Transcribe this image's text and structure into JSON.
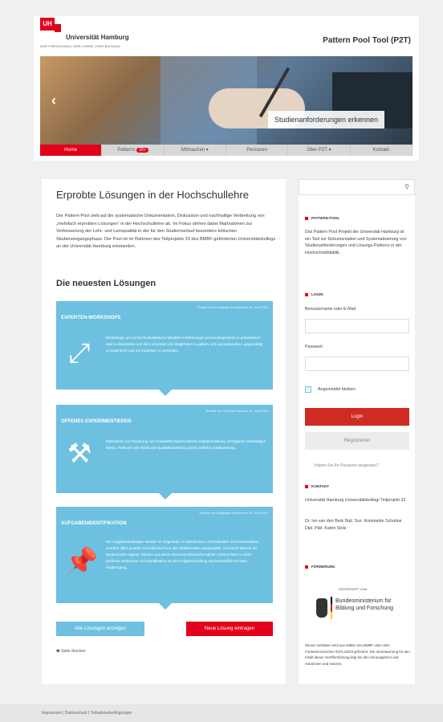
{
  "header": {
    "logo_text": "UH",
    "university": "Universität Hamburg",
    "tagline": "DER FORSCHUNG | DER LEHRE | DER BILDUNG",
    "tool_title": "Pattern Pool Tool (P2T)"
  },
  "hero": {
    "caption": "Studienanforderungen erkennen",
    "prev_icon": "chevron-left-icon"
  },
  "nav": {
    "items": [
      {
        "label": "Home"
      },
      {
        "label": "Patterns",
        "badge": "20+"
      },
      {
        "label": "Mitmachen ▾"
      },
      {
        "label": "Personen"
      },
      {
        "label": "Über P2T ▾"
      },
      {
        "label": "Kontakt"
      }
    ]
  },
  "main": {
    "title": "Erprobte Lösungen in der Hochschullehre",
    "intro": "Der Pattern-Pool zielt auf die systematische Dokumentation, Diskussion und nachhaltige Verbreitung von „mehrfach erprobten Lösungen“ in der Hochschullehre ab. Im Fokus stehen dabei Maßnahmen zur Verbesserung der Lehr- und Lernqualität in der für den Studienverlauf besonders kritischen Studieneingangsphase. Der Pool ist im Rahmen des Teilprojekts 33 des BMBF-geförderten Universitätskollegs an der Universität Hamburg entstanden.",
    "section_title": "Die neuesten Lösungen",
    "cards": [
      {
        "meta": "Erstellt von Konstantin Schultes am 24. Juni 2016",
        "title": "EXPERTEN-WORKSHOPS",
        "text": "Workshops, um hochschuldidaktische fakultäre Insellösungen prozessbegleitend zu präsentieren und zu diskutieren und den Lehrenden die Möglichkeit zu geben, sich auszutauschen, gegenseitig zu inspirieren und mit Expertise zu versorgen.",
        "icon": "expand-arrows-icon"
      },
      {
        "meta": "Erstellt von Thomas Haidl am 16. Juni 2016",
        "title": "OFFENES EXPERIMENTIEREN",
        "text": "Maßnahme zur Förderung von Kreativität ergebnisoffene Aufgabenstellung. Ermöglicht nachhaltiges lernen. Reflexion der Inhalt und Qualitätssicherung durch zeitliche Strukturierung.",
        "icon": "hammer-icon"
      },
      {
        "meta": "Erstellt von Wolfgang Reichert am 16. Juni 2016",
        "title": "AUFGABENIDENTIFIKATION",
        "text": "Die Aufgabenstellungen werden im Gegensatz zu klassischen Lehrmethoden nicht konkretisiert, sondern offen gestellt und individuell von den Studierenden ausgestaltet. Hierdurch können die Studierenden eigene Themen aus deren Interessensbereiche wählen. Dieses führt zu einer größeren Motivation und Identifikation mit der Aufgabenstellung und letztendlich mit dem Studiengang.",
        "icon": "pushpin-icon"
      }
    ],
    "show_all_label": "Alle Lösungen anzeigen",
    "new_solution_label": "Neue Lösung eintragen",
    "print_label": "Seite drucken"
  },
  "sidebar": {
    "search_placeholder": "",
    "pattern_pool": {
      "heading": "PATTERN POOL",
      "text": "Das Pattern Pool Projekt der Universität Hamburg ist ein Tool zur Dokumentation und Systematisierung von Studienanforderungen und Lösungs-Patterns in der Hochschuldidaktik."
    },
    "login": {
      "heading": "LOGIN",
      "user_label": "Benutzername oder E-Mail",
      "password_label": "Passwort",
      "remember_label": "Angemeldet bleiben",
      "login_button": "Login",
      "register_button": "Registrieren",
      "forgot": "Haben Sie Ihr Passwort vergessen?"
    },
    "kontakt": {
      "heading": "KONTAKT",
      "org": "Universität Hamburg Universitätskolleg/ Teilprojekt 33",
      "people": "Dr. Ivo van den Berk Dipl. Soz. Konstantin Schultes Dipl. Päd. Katrin Stolz"
    },
    "foerderung": {
      "heading": "FÖRDERUNG",
      "gefoerdert": "GEFÖRDERT VOM",
      "ministry": "Bundesministerium für Bildung und Forschung",
      "note": "Dieses Vorhaben wird aus Mitteln des BMBF unter dem Förderkennzeichen 01PL12033 gefördert. Die Verantwortung für den Inhalt dieser Veröffentlichung liegt bei den Herausgebern und Autorinnen und Autoren."
    }
  },
  "footer": {
    "links": "Impressum | Datenschutz | Teilnahmebedingungen"
  },
  "colors": {
    "accent": "#e2001a",
    "card": "#6dc0e0"
  }
}
